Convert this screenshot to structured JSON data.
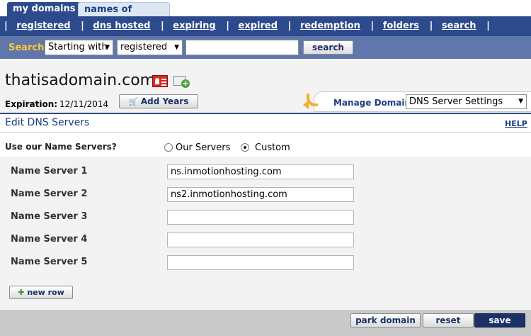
{
  "tabs": [
    {
      "label": "my domains",
      "active": true
    },
    {
      "label": "names of interest",
      "active": false
    }
  ],
  "nav": {
    "separator": "|",
    "links": [
      "registered",
      "dns hosted",
      "expiring",
      "expired",
      "redemption",
      "folders",
      "search"
    ]
  },
  "search": {
    "label": "Search",
    "mode_select": "Starting with",
    "scope_select": "registered",
    "query_value": "",
    "button_label": "search"
  },
  "domain": {
    "name": "thatisadomain.com",
    "expiration_label": "Expiration:",
    "expiration_value": "12/11/2014",
    "add_years_label": "Add Years",
    "manage_label": "Manage Domain:",
    "manage_value": "DNS Server Settings"
  },
  "section": {
    "title": "Edit DNS Servers",
    "help_label": "HELP"
  },
  "name_servers": {
    "question": "Use our Name Servers?",
    "option_ours": "Our Servers",
    "option_custom": "Custom",
    "selected": "Custom",
    "fields": [
      {
        "label": "Name Server 1",
        "value": "ns.inmotionhosting.com"
      },
      {
        "label": "Name Server 2",
        "value": "ns2.inmotionhosting.com"
      },
      {
        "label": "Name Server 3",
        "value": ""
      },
      {
        "label": "Name Server 4",
        "value": ""
      },
      {
        "label": "Name Server 5",
        "value": ""
      }
    ],
    "new_row_label": "new row"
  },
  "footer": {
    "park_label": "park domain",
    "reset_label": "reset",
    "save_label": "save"
  },
  "colors": {
    "nav_blue": "#2c4a8c",
    "search_bar": "#5f77ab",
    "search_label": "#ffc92e",
    "save_button": "#1c3168"
  },
  "icons": [
    "contact-card-icon",
    "add-folder-icon",
    "cart-icon",
    "back-arrow-icon",
    "dropdown-arrow-icon",
    "plus-icon"
  ]
}
